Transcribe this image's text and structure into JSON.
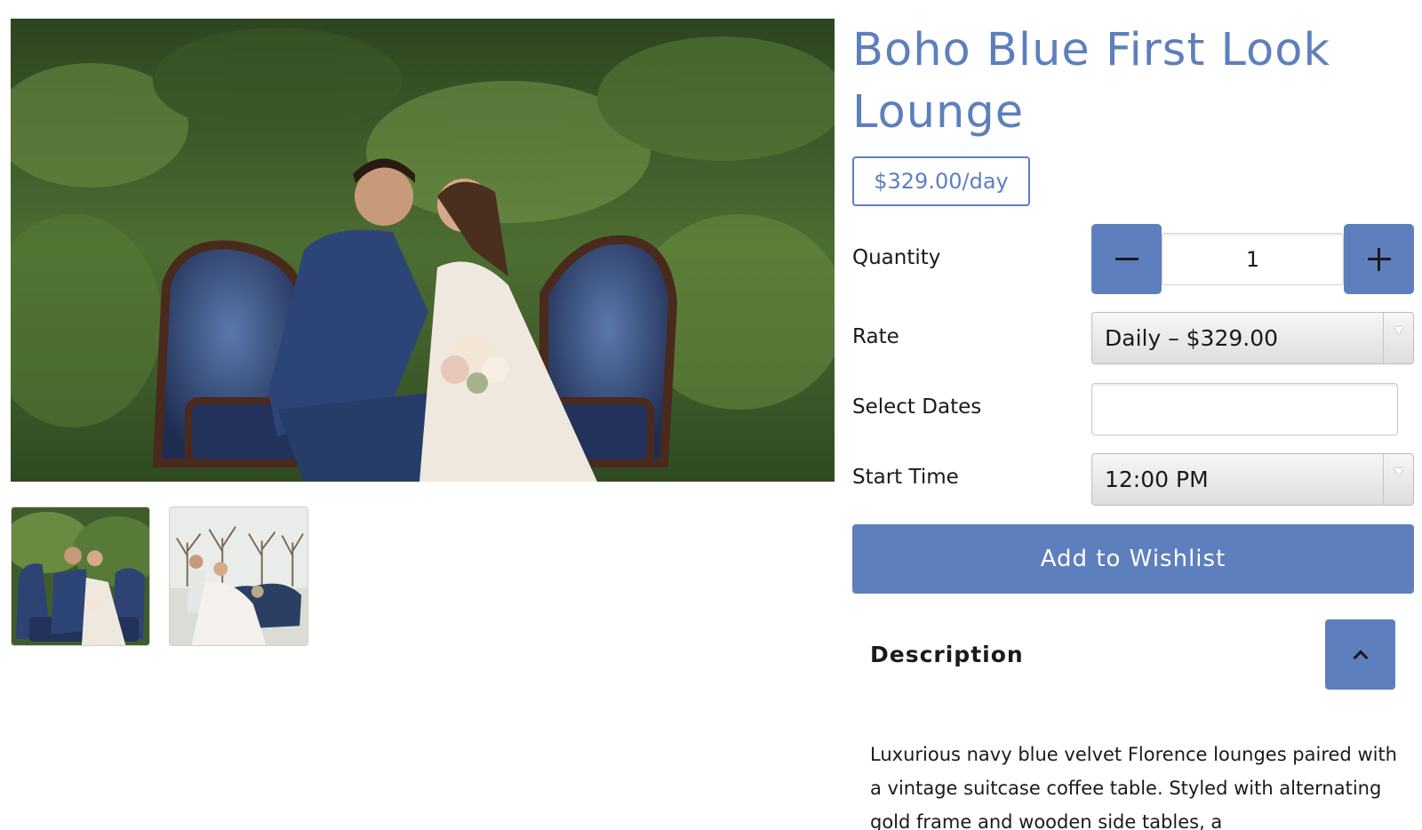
{
  "product": {
    "title": "Boho Blue First Look Lounge",
    "price": "$329.00/day"
  },
  "gallery": {
    "main_image": "couple-kissing-on-blue-velvet-lounge-photo",
    "thumbnails": [
      "couple-on-blue-lounge-thumbnail",
      "couple-on-blue-lounge-orchard-thumbnail"
    ]
  },
  "form": {
    "quantity_label": "Quantity",
    "quantity_value": "1",
    "rate_label": "Rate",
    "rate_value": "Daily – $329.00",
    "dates_label": "Select Dates",
    "dates_value": "",
    "start_time_label": "Start Time",
    "start_time_value": "12:00 PM"
  },
  "actions": {
    "wishlist_label": "Add to Wishlist"
  },
  "description": {
    "heading": "Description",
    "text": "Luxurious navy blue velvet Florence lounges paired with a vintage suitcase coffee table. Styled with alternating gold frame and wooden side tables, a"
  },
  "colors": {
    "accent": "#5e7fbd",
    "text": "#1a1a1a"
  }
}
